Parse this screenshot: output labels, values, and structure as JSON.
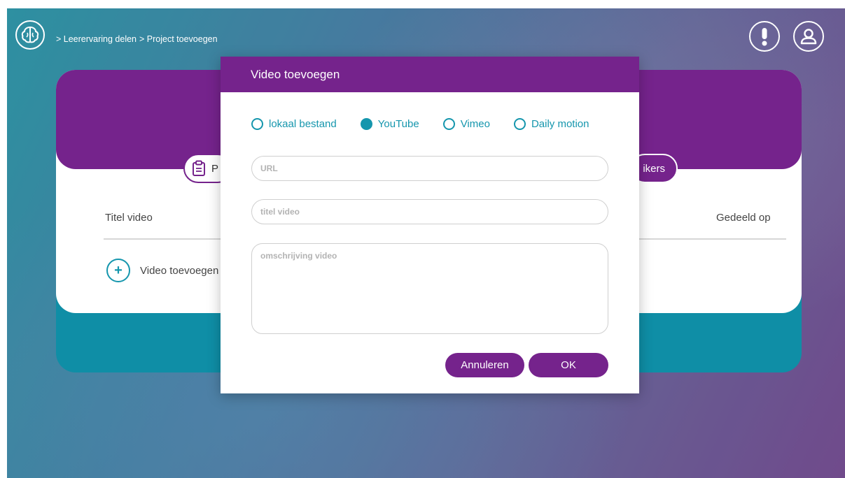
{
  "breadcrumb": {
    "items": [
      "> Leerervaring delen",
      "> Project toevoegen"
    ]
  },
  "header": {
    "logo_icon": "brain-icon",
    "alert_icon": "exclamation-icon",
    "user_icon": "user-icon"
  },
  "card": {
    "tab_left_text": "P",
    "tab_right_text": "ikers",
    "col_title": "Titel video",
    "col_shared": "Gedeeld op",
    "add_video_label": "Video toevoegen"
  },
  "modal": {
    "title": "Video toevoegen",
    "source_options": [
      {
        "label": "lokaal bestand",
        "checked": false
      },
      {
        "label": "YouTube",
        "checked": true
      },
      {
        "label": "Vimeo",
        "checked": false
      },
      {
        "label": "Daily motion",
        "checked": false
      }
    ],
    "url_placeholder": "URL",
    "title_placeholder": "titel video",
    "description_placeholder": "omschrijving video",
    "cancel_label": "Annuleren",
    "ok_label": "OK"
  },
  "colors": {
    "purple": "#75238c",
    "teal": "#1596ad",
    "teal_dark": "#0f8ea6"
  }
}
